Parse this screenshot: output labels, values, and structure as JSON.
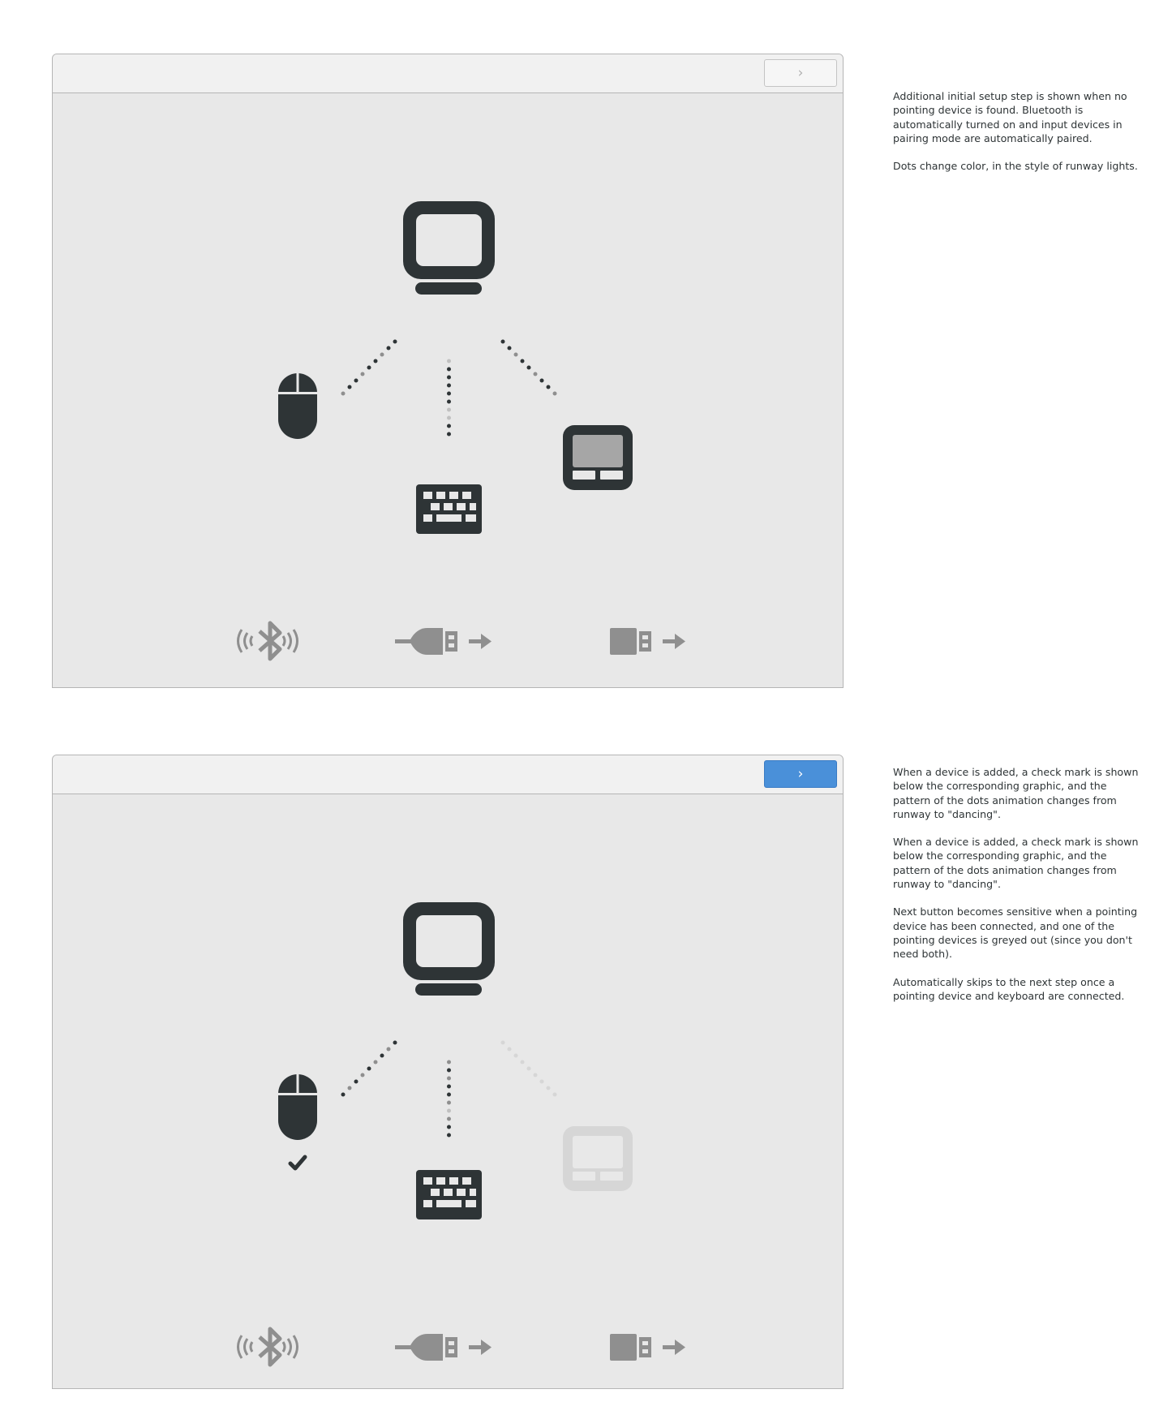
{
  "panels": [
    {
      "id": "initial",
      "next_button": {
        "label": "›",
        "state": "insensitive"
      },
      "devices": {
        "mouse_added": false,
        "touchpad_greyed": false
      },
      "notes": [
        "Additional initial setup step is shown when no pointing device is found. Bluetooth is automatically turned on and input devices in pairing mode are automatically paired.",
        "Dots change color, in the style of runway lights."
      ]
    },
    {
      "id": "device-added",
      "next_button": {
        "label": "›",
        "state": "sensitive"
      },
      "devices": {
        "mouse_added": true,
        "touchpad_greyed": true
      },
      "notes": [
        "When a device is added, a check mark is shown below the corresponding graphic, and the pattern of the dots animation changes from runway to \"dancing\".",
        "When a device is added, a check mark is shown below the corresponding graphic, and the pattern of the dots animation changes from runway to \"dancing\".",
        "Next button becomes sensitive when a pointing device has been connected, and one of the pointing devices is greyed out (since you don't need both).",
        "Automatically skips to the next step once a pointing device and keyboard are connected."
      ]
    }
  ],
  "connection_icons": [
    "bluetooth-icon",
    "usb-cable-icon",
    "usb-dongle-icon"
  ],
  "colors": {
    "dark": "#2e3436",
    "grey": "#8f8f8f",
    "light": "#c0c0c0",
    "faded": "#d6d6d6",
    "accent": "#4a90d9"
  }
}
